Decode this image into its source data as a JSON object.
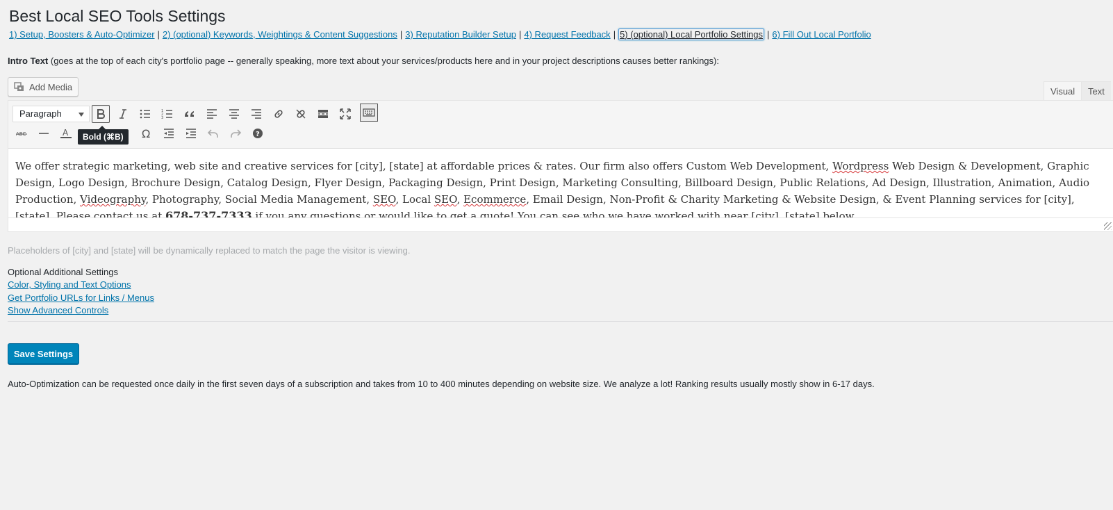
{
  "page": {
    "title": "Best Local SEO Tools Settings"
  },
  "nav": {
    "tabs": [
      {
        "label": "1) Setup, Boosters & Auto-Optimizer"
      },
      {
        "label": "2) (optional) Keywords, Weightings & Content Suggestions"
      },
      {
        "label": "3) Reputation Builder Setup"
      },
      {
        "label": "4) Request Feedback"
      },
      {
        "label": "5) (optional) Local Portfolio Settings"
      },
      {
        "label": "6) Fill Out Local Portfolio"
      }
    ],
    "separator": "|"
  },
  "intro": {
    "label": "Intro Text",
    "hint": " (goes at the top of each city's portfolio page -- generally speaking, more text about your services/products here and in your project descriptions causes better rankings):"
  },
  "editor": {
    "add_media_label": "Add Media",
    "tab_visual": "Visual",
    "tab_text": "Text",
    "format_select": "Paragraph",
    "tooltip": "Bold (⌘B)",
    "content": {
      "p1": "We offer strategic marketing, web site and creative services for [city], [state] at affordable prices & rates. Our firm also offers Custom Web Development, ",
      "w1": "Wordpress",
      "p2": " Web Design & Development, Graphic Design, Logo Design, Brochure Design, Catalog Design, Flyer Design, Packaging Design, Print Design, Marketing Consulting, Billboard Design, Public Relations, Ad Design, Illustration, Animation, Audio Production, ",
      "w2": "Videography",
      "p3": ", Photography, Social Media Management, ",
      "w3": "SEO",
      "p4": ", Local ",
      "w4": "SEO",
      "p5": ", ",
      "w5": "Ecommerce",
      "p6": ", Email Design, Non-Profit & Charity Marketing & Website Design, & Event Planning services for [city], [state]. Please contact us at ",
      "phone": "678-737-7333",
      "p7": " if you any questions or would like to get a quote! You can see who we have worked with near [city], [state] below."
    }
  },
  "placeholder_note": "Placeholders of [city] and [state] will be dynamically replaced to match the page the visitor is viewing.",
  "optional": {
    "title": "Optional Additional Settings",
    "links": [
      {
        "label": "Color, Styling and Text Options"
      },
      {
        "label": "Get Portfolio URLs for Links / Menus"
      },
      {
        "label": "Show Advanced Controls"
      }
    ]
  },
  "save_label": "Save Settings",
  "footer_note": "Auto-Optimization can be requested once daily in the first seven days of a subscription and takes from 10 to 400 minutes depending on website size. We analyze a lot! Ranking results usually mostly show in 6-17 days.",
  "colors": {
    "link": "#0073aa",
    "primary_button": "#0085ba",
    "tooltip_bg": "#23282d"
  }
}
